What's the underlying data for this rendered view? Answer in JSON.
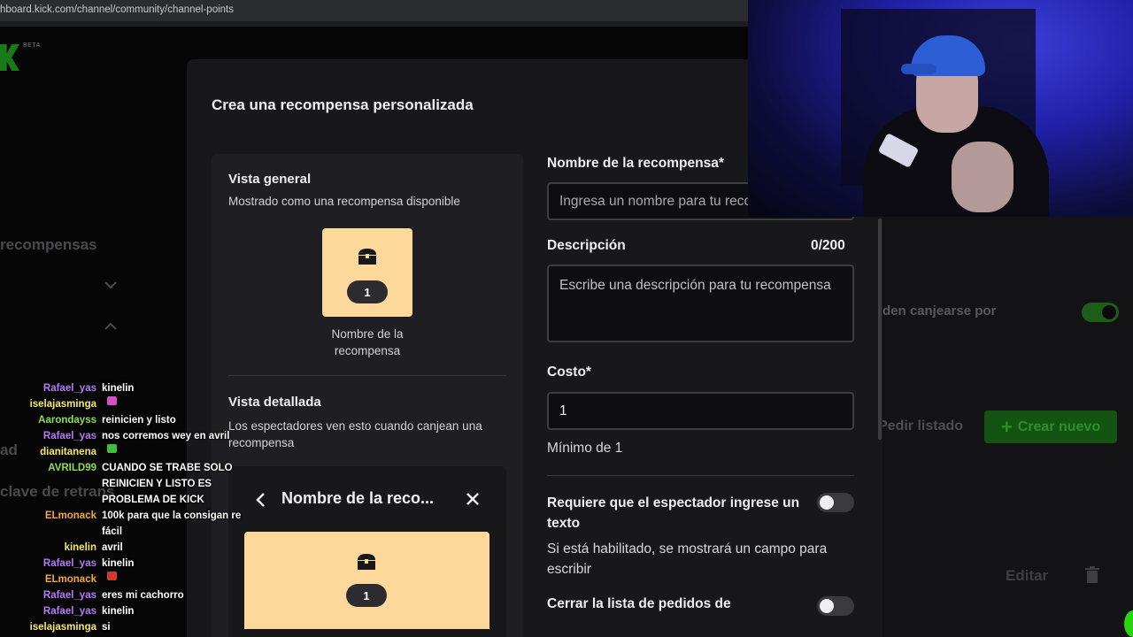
{
  "browser": {
    "url": "hboard.kick.com/channel/community/channel-points"
  },
  "logo": {
    "beta": "BETA"
  },
  "background": {
    "rewards_heading": "recompensas",
    "ad_label": "ad",
    "stream_key_label": "clave de retrans",
    "redeem_label": "den canjearse por",
    "request_list": "Pedir listado",
    "create_new": "Crear nuevo",
    "edit": "Editar"
  },
  "modal": {
    "title": "Crea una recompensa personalizada",
    "preview": {
      "general_title": "Vista general",
      "general_sub": "Mostrado como una recompensa disponible",
      "cost": "1",
      "reward_name": "Nombre de la recompensa",
      "detailed_title": "Vista detallada",
      "detailed_sub": "Los espectadores ven esto cuando canjean una recompensa",
      "detail_card_title": "Nombre de la reco..."
    },
    "form": {
      "name_label": "Nombre de la recompensa*",
      "name_placeholder": "Ingresa un nombre para tu recompensa",
      "description_label": "Descripción",
      "description_counter": "0/200",
      "description_placeholder": "Escribe una descripción para tu recompensa",
      "cost_label": "Costo*",
      "cost_value": "1",
      "cost_min": "Mínimo de 1",
      "require_text_label": "Requiere que el espectador ingrese un texto",
      "require_text_help": "Si está habilitado, se mostrará un campo para escribir",
      "close_requests_label": "Cerrar la lista de pedidos de"
    }
  },
  "chat": [
    {
      "user": "Rafael_yas",
      "color": "#b27cf5",
      "msg": "kinelin"
    },
    {
      "user": "iselajasminga",
      "color": "#f5e96a",
      "msg": "",
      "emote": "#d24fc4"
    },
    {
      "user": "Aarondayss",
      "color": "#8fdc55",
      "msg": "reinicien y listo"
    },
    {
      "user": "Rafael_yas",
      "color": "#b27cf5",
      "msg": "nos corremos wey en avril"
    },
    {
      "user": "dianitanena",
      "color": "#f5e96a",
      "msg": "",
      "emote": "#3fbf3a"
    },
    {
      "user": "AVRILD99",
      "color": "#8fdc55",
      "msg": "CUANDO SE TRABE SOLO REINICIEN Y LISTO ES PROBLEMA DE KICK"
    },
    {
      "user": "ELmonack",
      "color": "#f4a93c",
      "msg": "100k para que la consigan re fácil"
    },
    {
      "user": "kinelin",
      "color": "#f5e96a",
      "msg": "avril"
    },
    {
      "user": "Rafael_yas",
      "color": "#b27cf5",
      "msg": "kinelin"
    },
    {
      "user": "ELmonack",
      "color": "#f4a93c",
      "msg": "",
      "emote": "#d03a2c"
    },
    {
      "user": "Rafael_yas",
      "color": "#b27cf5",
      "msg": "eres mi cachorro"
    },
    {
      "user": "Rafael_yas",
      "color": "#b27cf5",
      "msg": "kinelin"
    },
    {
      "user": "iselajasminga",
      "color": "#f5e96a",
      "msg": "si"
    }
  ]
}
